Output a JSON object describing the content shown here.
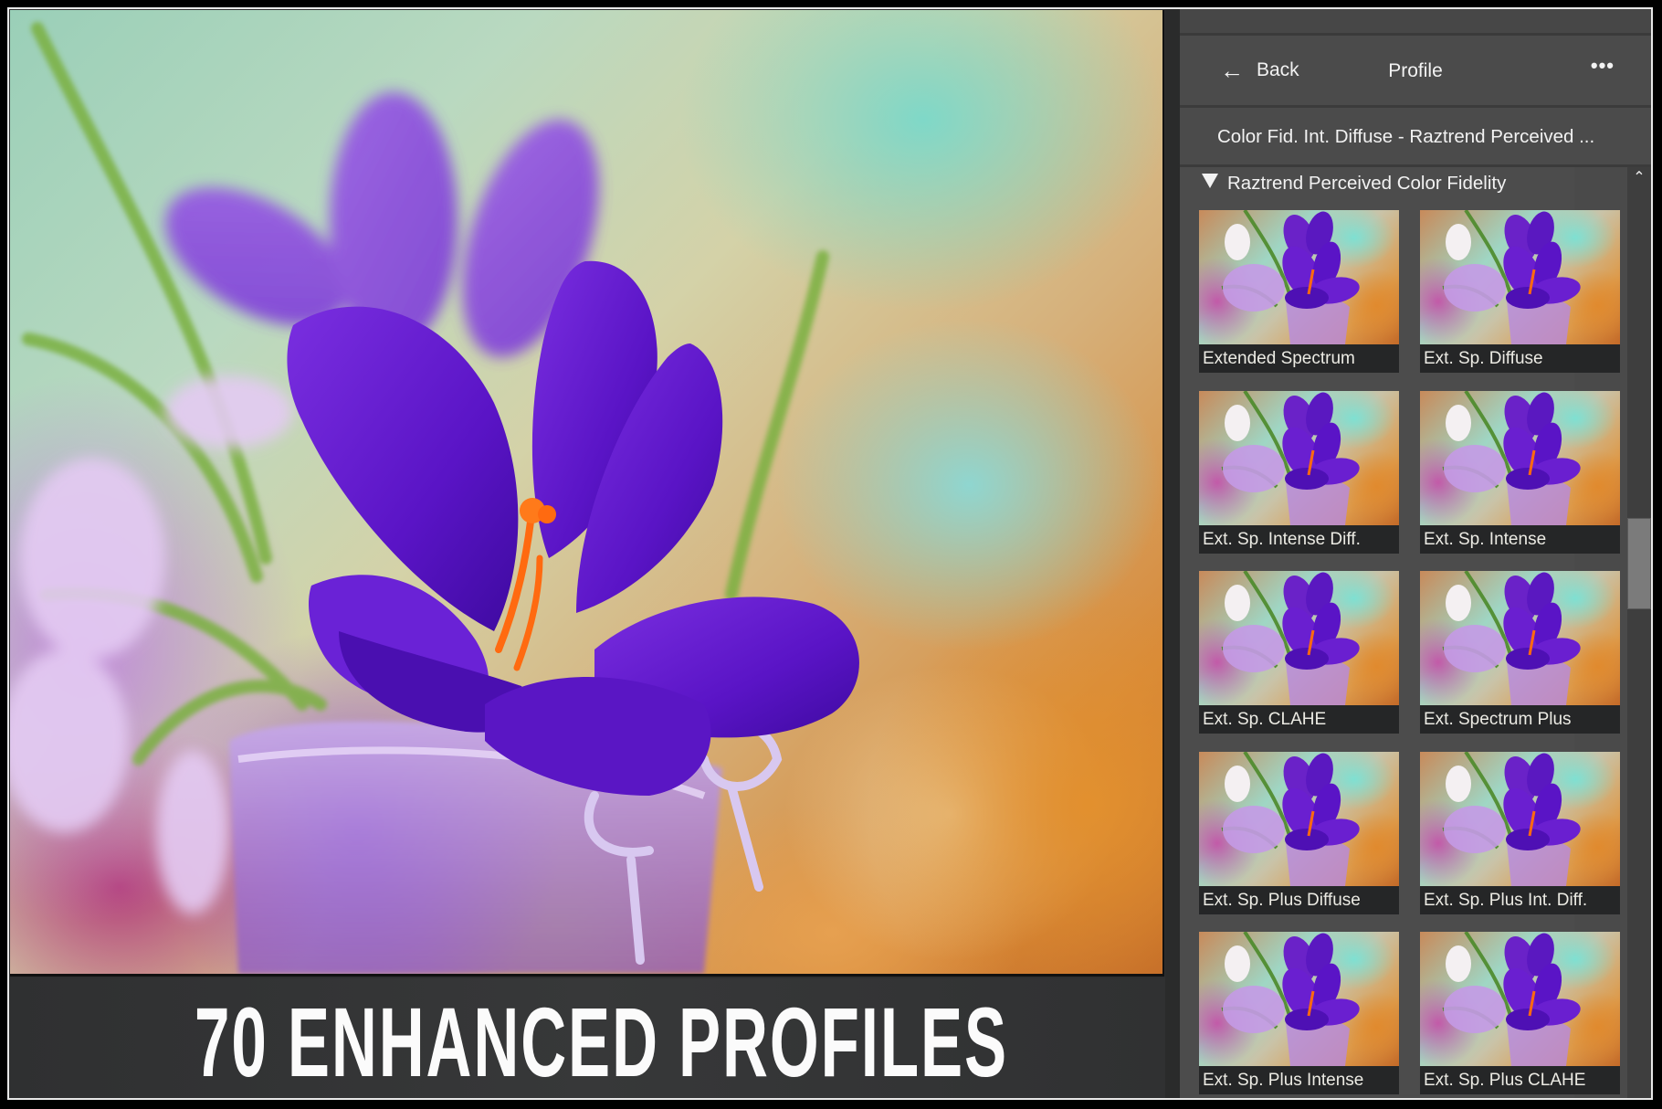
{
  "banner": {
    "text": "70 ENHANCED PROFILES"
  },
  "panel": {
    "back_label": "Back",
    "back_icon": "arrow-left-icon",
    "title": "Profile",
    "more_icon": "more-horizontal-icon",
    "more_glyph": "•••",
    "selected_profile": "Color Fid. Int. Diffuse - Raztrend Perceived ...",
    "group": {
      "expanded": true,
      "label": "Raztrend Perceived Color Fidelity",
      "icon": "triangle-down-icon"
    },
    "scroll_up_icon": "chevron-up-icon",
    "scroll_up_glyph": "⌃",
    "profiles": [
      {
        "label": "Extended Spectrum"
      },
      {
        "label": "Ext. Sp. Diffuse"
      },
      {
        "label": "Ext. Sp. Intense Diff."
      },
      {
        "label": "Ext. Sp. Intense"
      },
      {
        "label": "Ext. Sp. CLAHE"
      },
      {
        "label": "Ext. Spectrum Plus"
      },
      {
        "label": "Ext. Sp. Plus Diffuse"
      },
      {
        "label": "Ext. Sp. Plus Int. Diff."
      },
      {
        "label": "Ext. Sp. Plus Intense"
      },
      {
        "label": "Ext. Sp. Plus CLAHE"
      }
    ]
  },
  "colors": {
    "panel_bg": "#4a4a4a",
    "caption_bg": "#252627",
    "banner_bg": "#333435",
    "petal": "#6a1fd0",
    "stamen": "#ff6a10"
  }
}
